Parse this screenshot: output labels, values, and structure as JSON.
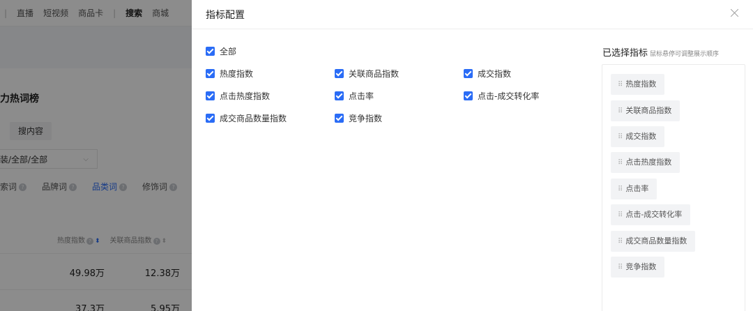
{
  "background": {
    "nav": {
      "items": [
        "直播",
        "短视频",
        "商品卡",
        "搜索",
        "商城"
      ],
      "active": "搜索"
    },
    "section_title": "潜力热词榜",
    "chip": "搜内容",
    "select_value": "装/全部/全部",
    "tabs": [
      {
        "label": "索词",
        "active": false
      },
      {
        "label": "品牌词",
        "active": false
      },
      {
        "label": "品类词",
        "active": true
      },
      {
        "label": "修饰词",
        "active": false
      }
    ],
    "table": {
      "headers": [
        "热度指数",
        "关联商品指数"
      ],
      "rows": [
        {
          "heat": "49.98万",
          "related": "12.38万"
        },
        {
          "heat": "37.3万",
          "related": "5.95万"
        }
      ]
    }
  },
  "drawer": {
    "title": "指标配置",
    "select_all": {
      "label": "全部",
      "checked": true
    },
    "metrics": [
      {
        "label": "热度指数",
        "checked": true
      },
      {
        "label": "关联商品指数",
        "checked": true
      },
      {
        "label": "成交指数",
        "checked": true
      },
      {
        "label": "点击热度指数",
        "checked": true
      },
      {
        "label": "点击率",
        "checked": true
      },
      {
        "label": "点击-成交转化率",
        "checked": true
      },
      {
        "label": "成交商品数量指数",
        "checked": true
      },
      {
        "label": "竞争指数",
        "checked": true
      }
    ],
    "selected": {
      "heading": "已选择指标",
      "hint": "鼠标悬停可调整展示顺序",
      "items": [
        "热度指数",
        "关联商品指数",
        "成交指数",
        "点击热度指数",
        "点击率",
        "点击-成交转化率",
        "成交商品数量指数",
        "竞争指数"
      ]
    }
  },
  "colors": {
    "accent": "#2a6cf6",
    "chip_bg": "#f2f3f5",
    "overlay": "rgba(0,0,0,0.45)"
  }
}
